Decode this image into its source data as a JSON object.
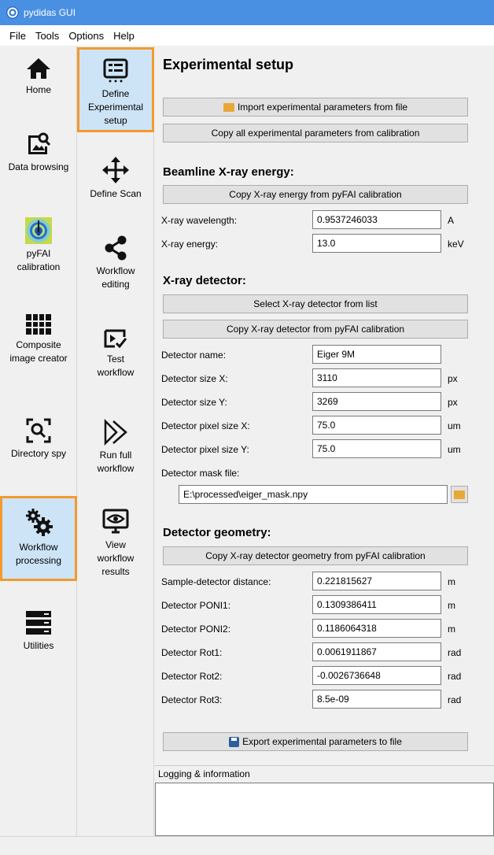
{
  "window": {
    "title": "pydidas GUI"
  },
  "menu": [
    "File",
    "Tools",
    "Options",
    "Help"
  ],
  "sidebar": [
    {
      "label": "Home",
      "icon": "home-icon"
    },
    {
      "label": "Data browsing",
      "icon": "image-search-icon"
    },
    {
      "label": "pyFAI calibration",
      "icon": "pyfai-calibration-icon"
    },
    {
      "label": "Composite image creator",
      "icon": "grid-icon"
    },
    {
      "label": "Directory spy",
      "icon": "search-frame-icon"
    },
    {
      "label": "Workflow processing",
      "icon": "gears-icon",
      "active": true
    },
    {
      "label": "Utilities",
      "icon": "server-icon"
    }
  ],
  "subnav": [
    {
      "label": "Define Experimental setup",
      "icon": "experiment-panel-icon",
      "active": true
    },
    {
      "label": "Define Scan",
      "icon": "move-arrows-icon"
    },
    {
      "label": "Workflow editing",
      "icon": "share-icon"
    },
    {
      "label": "Test workflow",
      "icon": "test-play-icon"
    },
    {
      "label": "Run full workflow",
      "icon": "fast-forward-icon"
    },
    {
      "label": "View workflow results",
      "icon": "monitor-eye-icon"
    }
  ],
  "main": {
    "title": "Experimental setup",
    "import_button": "Import experimental parameters from file",
    "copy_all_button": "Copy all experimental parameters from calibration",
    "beamline": {
      "title": "Beamline X-ray energy:",
      "copy_button": "Copy X-ray energy from pyFAI calibration",
      "wavelength": {
        "label": "X-ray wavelength:",
        "value": "0.9537246033",
        "unit": "A"
      },
      "energy": {
        "label": "X-ray energy:",
        "value": "13.0",
        "unit": "keV"
      }
    },
    "detector": {
      "title": "X-ray detector:",
      "select_button": "Select X-ray detector from list",
      "copy_button": "Copy X-ray detector from pyFAI calibration",
      "name": {
        "label": "Detector name:",
        "value": "Eiger 9M"
      },
      "size_x": {
        "label": "Detector size X:",
        "value": "3110",
        "unit": "px"
      },
      "size_y": {
        "label": "Detector size Y:",
        "value": "3269",
        "unit": "px"
      },
      "pixel_x": {
        "label": "Detector pixel size X:",
        "value": "75.0",
        "unit": "um"
      },
      "pixel_y": {
        "label": "Detector pixel size Y:",
        "value": "75.0",
        "unit": "um"
      },
      "mask": {
        "label": "Detector mask file:",
        "value": "E:\\processed\\eiger_mask.npy"
      }
    },
    "geometry": {
      "title": "Detector geometry:",
      "copy_button": "Copy X-ray detector geometry from pyFAI calibration",
      "distance": {
        "label": "Sample-detector distance:",
        "value": "0.221815627",
        "unit": "m"
      },
      "poni1": {
        "label": "Detector PONI1:",
        "value": "0.1309386411",
        "unit": "m"
      },
      "poni2": {
        "label": "Detector PONI2:",
        "value": "0.1186064318",
        "unit": "m"
      },
      "rot1": {
        "label": "Detector Rot1:",
        "value": "0.0061911867",
        "unit": "rad"
      },
      "rot2": {
        "label": "Detector Rot2:",
        "value": "-0.0026736648",
        "unit": "rad"
      },
      "rot3": {
        "label": "Detector Rot3:",
        "value": "8.5e-09",
        "unit": "rad"
      }
    },
    "export_button": "Export experimental parameters to file"
  },
  "logging": {
    "title": "Logging & information"
  }
}
